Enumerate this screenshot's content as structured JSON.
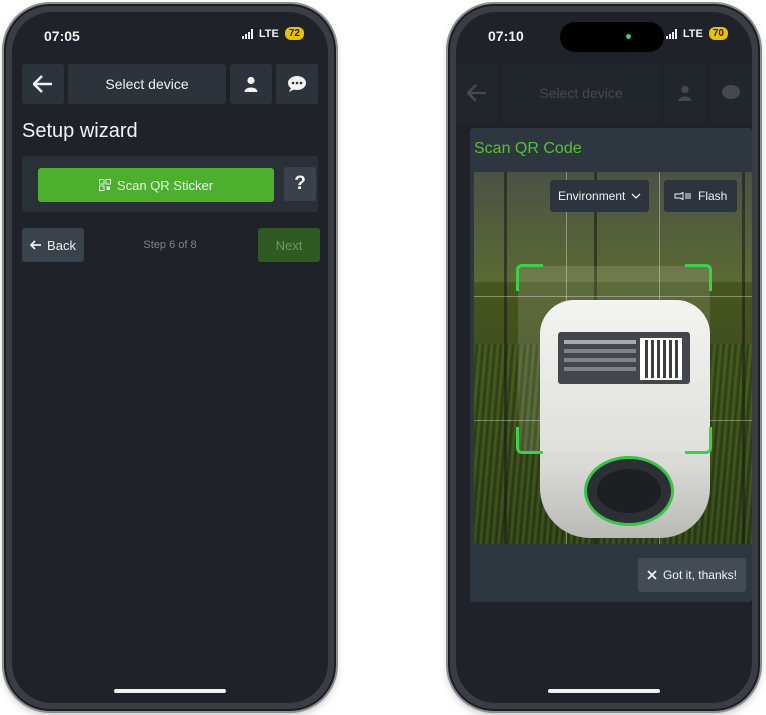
{
  "phone_left": {
    "status": {
      "time": "07:05",
      "network": "LTE",
      "battery": "72"
    },
    "topbar": {
      "title": "Select device",
      "back_icon": "arrow-left-icon",
      "user_icon": "user-icon",
      "chat_icon": "chat-icon"
    },
    "heading": "Setup wizard",
    "scan_button": "Scan QR Sticker",
    "help_button": "?",
    "back_button": "Back",
    "step": "Step 6 of 8",
    "next_button": "Next"
  },
  "phone_right": {
    "status": {
      "time": "07:10",
      "network": "LTE",
      "battery": "70"
    },
    "topbar": {
      "title": "Select device"
    },
    "modal": {
      "title": "Scan QR Code",
      "camera_select": "Environment",
      "flash_button": "Flash",
      "dismiss_button": "Got it, thanks!"
    }
  },
  "colors": {
    "accent": "#4caf2e",
    "accent_text": "#55c23a",
    "background": "#1f2329",
    "surface": "#2d333b"
  }
}
